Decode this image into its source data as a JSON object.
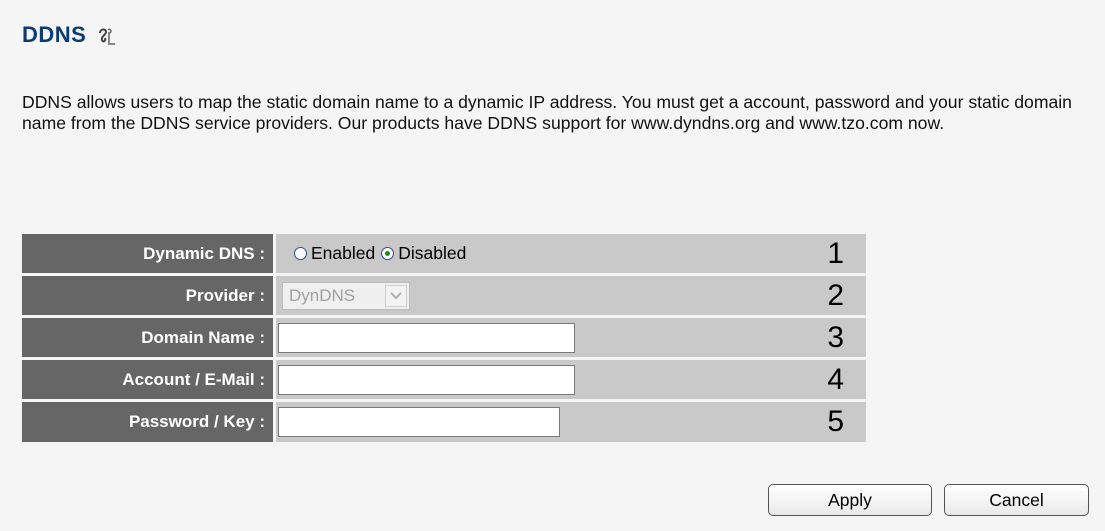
{
  "header": {
    "title": "DDNS",
    "help_icon": "help-icon"
  },
  "description": "DDNS allows users to map the static domain name to a dynamic IP address. You must get a account, password and your static domain name from the DDNS service providers. Our products have DDNS support for www.dyndns.org and www.tzo.com now.",
  "form": {
    "dynamic_dns": {
      "label": "Dynamic DNS :",
      "options": [
        {
          "label": "Enabled",
          "checked": false
        },
        {
          "label": "Disabled",
          "checked": true
        }
      ],
      "marker": "1"
    },
    "provider": {
      "label": "Provider :",
      "value": "DynDNS",
      "disabled": true,
      "marker": "2"
    },
    "domain_name": {
      "label": "Domain Name :",
      "value": "",
      "marker": "3"
    },
    "account": {
      "label": "Account / E-Mail :",
      "value": "",
      "marker": "4"
    },
    "password": {
      "label": "Password / Key :",
      "value": "",
      "marker": "5"
    }
  },
  "buttons": {
    "apply": "Apply",
    "cancel": "Cancel"
  },
  "colors": {
    "title": "#0b3a78",
    "label_bg": "#666666",
    "value_bg": "#c9c9c9",
    "page_bg": "#f5f5f5"
  }
}
